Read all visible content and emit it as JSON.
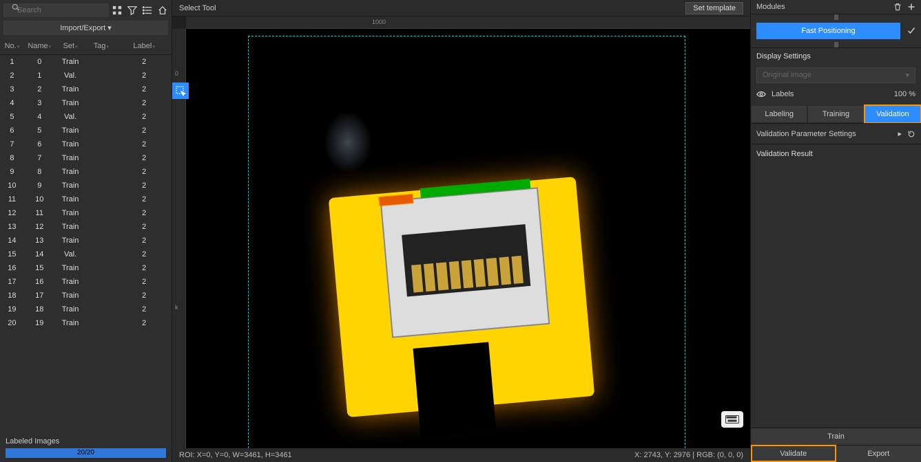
{
  "left": {
    "search_placeholder": "Search",
    "import_export": "Import/Export ▾",
    "columns": [
      "No.",
      "Name",
      "Set",
      "Tag",
      "Label"
    ],
    "rows": [
      {
        "no": "1",
        "name": "0",
        "set": "Train",
        "tag": "",
        "label": "2"
      },
      {
        "no": "2",
        "name": "1",
        "set": "Val.",
        "tag": "",
        "label": "2"
      },
      {
        "no": "3",
        "name": "2",
        "set": "Train",
        "tag": "",
        "label": "2"
      },
      {
        "no": "4",
        "name": "3",
        "set": "Train",
        "tag": "",
        "label": "2"
      },
      {
        "no": "5",
        "name": "4",
        "set": "Val.",
        "tag": "",
        "label": "2"
      },
      {
        "no": "6",
        "name": "5",
        "set": "Train",
        "tag": "",
        "label": "2"
      },
      {
        "no": "7",
        "name": "6",
        "set": "Train",
        "tag": "",
        "label": "2"
      },
      {
        "no": "8",
        "name": "7",
        "set": "Train",
        "tag": "",
        "label": "2"
      },
      {
        "no": "9",
        "name": "8",
        "set": "Train",
        "tag": "",
        "label": "2"
      },
      {
        "no": "10",
        "name": "9",
        "set": "Train",
        "tag": "",
        "label": "2"
      },
      {
        "no": "11",
        "name": "10",
        "set": "Train",
        "tag": "",
        "label": "2"
      },
      {
        "no": "12",
        "name": "11",
        "set": "Train",
        "tag": "",
        "label": "2"
      },
      {
        "no": "13",
        "name": "12",
        "set": "Train",
        "tag": "",
        "label": "2"
      },
      {
        "no": "14",
        "name": "13",
        "set": "Train",
        "tag": "",
        "label": "2"
      },
      {
        "no": "15",
        "name": "14",
        "set": "Val.",
        "tag": "",
        "label": "2"
      },
      {
        "no": "16",
        "name": "15",
        "set": "Train",
        "tag": "",
        "label": "2"
      },
      {
        "no": "17",
        "name": "16",
        "set": "Train",
        "tag": "",
        "label": "2"
      },
      {
        "no": "18",
        "name": "17",
        "set": "Train",
        "tag": "",
        "label": "2"
      },
      {
        "no": "19",
        "name": "18",
        "set": "Train",
        "tag": "",
        "label": "2"
      },
      {
        "no": "20",
        "name": "19",
        "set": "Train",
        "tag": "",
        "label": "2"
      }
    ],
    "labeled_images_title": "Labeled Images",
    "progress_text": "20/20"
  },
  "viewport": {
    "tool_label": "Select Tool",
    "set_template": "Set template",
    "ruler_marks_h": [
      "1000"
    ],
    "ruler_marks_v": [
      "0",
      "k"
    ],
    "roi_text": "ROI: X=0, Y=0, W=3461, H=3461",
    "cursor_text": "X: 2743, Y: 2976 | RGB: (0, 0, 0)"
  },
  "right": {
    "modules_title": "Modules",
    "module_button": "Fast Positioning",
    "display_settings": "Display Settings",
    "image_select": "Original image",
    "labels_label": "Labels",
    "labels_value": "100 %",
    "tabs": [
      "Labeling",
      "Training",
      "Validation"
    ],
    "active_tab": 2,
    "param_title": "Validation Parameter Settings",
    "result_title": "Validation Result",
    "train_btn": "Train",
    "validate_btn": "Validate",
    "export_btn": "Export"
  }
}
